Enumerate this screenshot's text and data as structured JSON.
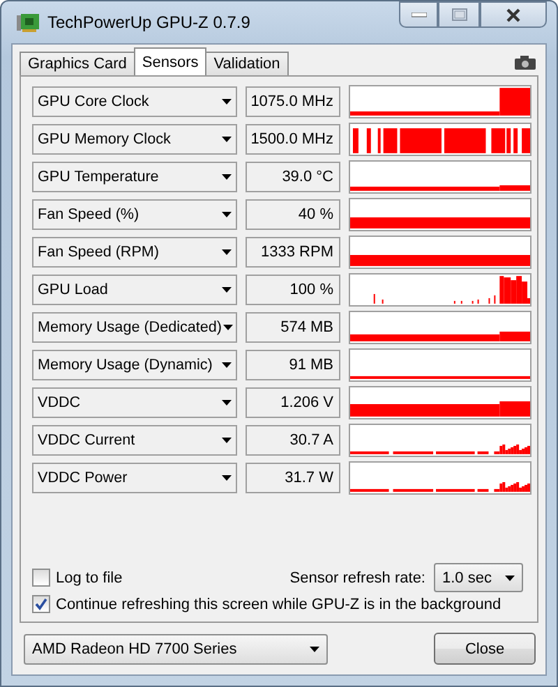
{
  "window": {
    "title": "TechPowerUp GPU-Z 0.7.9"
  },
  "tabs": [
    {
      "label": "Graphics Card",
      "selected": false
    },
    {
      "label": "Sensors",
      "selected": true
    },
    {
      "label": "Validation",
      "selected": false
    }
  ],
  "sensors": [
    {
      "name": "GPU Core Clock",
      "value": "1075.0 MHz"
    },
    {
      "name": "GPU Memory Clock",
      "value": "1500.0 MHz"
    },
    {
      "name": "GPU Temperature",
      "value": "39.0 °C"
    },
    {
      "name": "Fan Speed (%)",
      "value": "40 %"
    },
    {
      "name": "Fan Speed (RPM)",
      "value": "1333 RPM"
    },
    {
      "name": "GPU Load",
      "value": "100 %"
    },
    {
      "name": "Memory Usage (Dedicated)",
      "value": "574 MB"
    },
    {
      "name": "Memory Usage (Dynamic)",
      "value": "91 MB"
    },
    {
      "name": "VDDC",
      "value": "1.206 V"
    },
    {
      "name": "VDDC Current",
      "value": "30.7 A"
    },
    {
      "name": "VDDC Power",
      "value": "31.7 W"
    }
  ],
  "log_to_file": {
    "label": "Log to file",
    "checked": false
  },
  "refresh_rate": {
    "label": "Sensor refresh rate:",
    "value": "1.0 sec"
  },
  "continue_refreshing": {
    "label": "Continue refreshing this screen while GPU-Z is in the background",
    "checked": true
  },
  "gpu_select": {
    "value": "AMD Radeon HD 7700 Series"
  },
  "buttons": [
    "Close"
  ]
}
